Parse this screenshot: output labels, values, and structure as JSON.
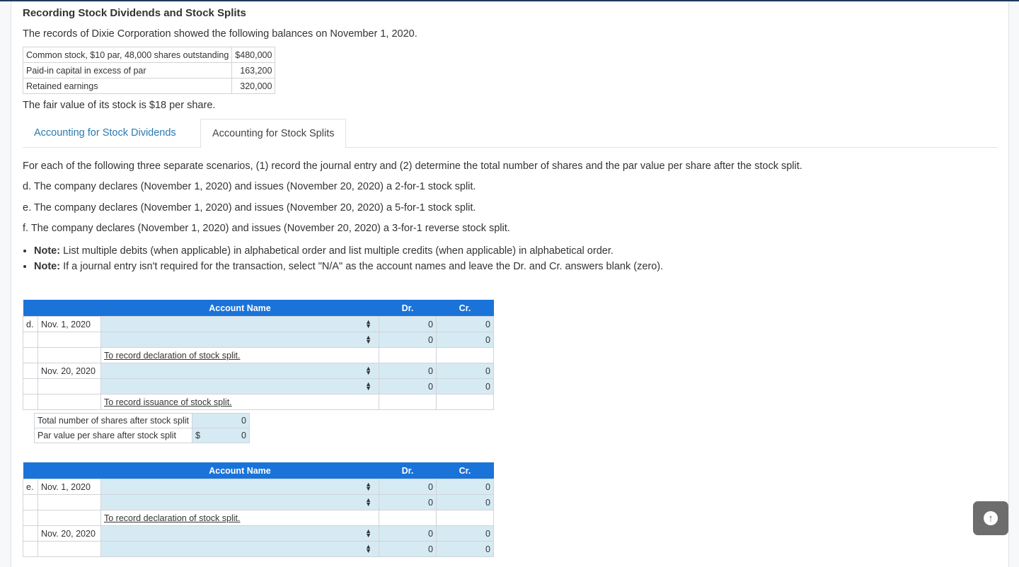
{
  "title": "Recording Stock Dividends and Stock Splits",
  "intro": "The records of Dixie Corporation showed the following balances on November 1, 2020.",
  "balances": [
    {
      "label": "Common stock, $10 par, 48,000 shares outstanding",
      "value": "$480,000"
    },
    {
      "label": "Paid-in capital in excess of par",
      "value": "163,200"
    },
    {
      "label": "Retained earnings",
      "value": "320,000"
    }
  ],
  "fair_value": "The fair value of its stock is $18 per share.",
  "tabs": [
    {
      "label": "Accounting for Stock Dividends",
      "active": false
    },
    {
      "label": "Accounting for Stock Splits",
      "active": true
    }
  ],
  "instructions": "For each of the following three separate scenarios, (1) record the journal entry and (2) determine the total number of shares and the par value per share after the stock split.",
  "scenarios": [
    "d. The company declares (November 1, 2020) and issues (November 20, 2020) a 2-for-1 stock split.",
    "e. The company declares (November 1, 2020) and issues (November 20, 2020) a 5-for-1 stock split.",
    "f. The company declares (November 1, 2020) and issues (November 20, 2020) a 3-for-1 reverse stock split."
  ],
  "notes": [
    {
      "bold": "Note:",
      "text": " List multiple debits (when applicable) in alphabetical order and list multiple credits (when applicable) in alphabetical order."
    },
    {
      "bold": "Note:",
      "text": " If a journal entry isn't required for the transaction, select \"N/A\" as the account names and leave the Dr. and Cr. answers blank (zero)."
    }
  ],
  "journal_headers": {
    "account": "Account Name",
    "dr": "Dr.",
    "cr": "Cr."
  },
  "journals": [
    {
      "label": "d.",
      "date1": "Nov. 1, 2020",
      "date2": "Nov. 20, 2020",
      "memo1": "To record declaration of stock split.",
      "memo2": "To record issuance of stock split.",
      "dr": [
        "0",
        "0",
        "0",
        "0"
      ],
      "cr": [
        "0",
        "0",
        "0",
        "0"
      ],
      "shares_label": "Total number of shares after stock split",
      "shares_value": "0",
      "par_label": "Par value per share after stock split",
      "par_currency": "$",
      "par_value": "0"
    },
    {
      "label": "e.",
      "date1": "Nov. 1, 2020",
      "date2": "Nov. 20, 2020",
      "memo1": "To record declaration of stock split.",
      "dr": [
        "0",
        "0",
        "0",
        "0"
      ],
      "cr": [
        "0",
        "0",
        "0",
        "0"
      ]
    }
  ]
}
